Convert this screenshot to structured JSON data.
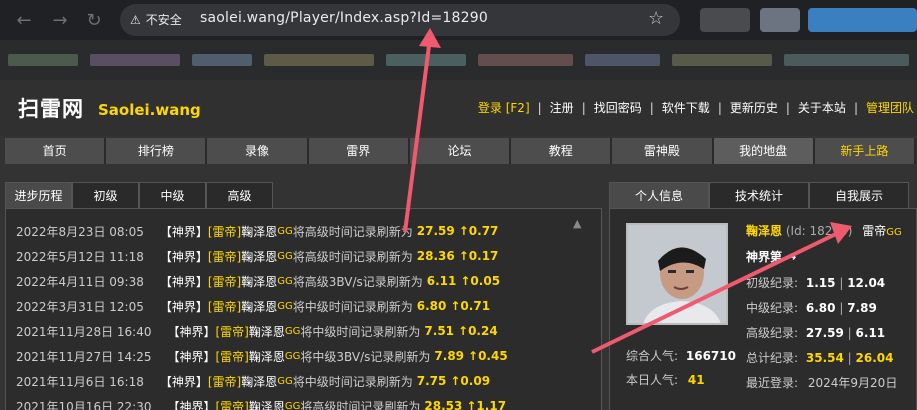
{
  "browser": {
    "security_label": "不安全",
    "url": "saolei.wang/Player/Index.asp?Id=18290"
  },
  "site": {
    "logo_cn": "扫雷网",
    "logo_en": "Saolei.wang",
    "top_links": [
      "登录 [F2]",
      "注册",
      "找回密码",
      "软件下载",
      "更新历史",
      "关于本站",
      "管理团队"
    ]
  },
  "nav": {
    "items": [
      "首页",
      "排行榜",
      "录像",
      "雷界",
      "论坛",
      "教程",
      "雷神殿",
      "我的地盘",
      "新手上路"
    ]
  },
  "left_tabs": [
    "进步历程",
    "初级",
    "中级",
    "高级"
  ],
  "records": [
    {
      "date": "2022年8月23日 08:05",
      "tag1": "【神界】",
      "tag2": "[雷帝]",
      "name": "鞠泽恩",
      "gg": "GG",
      "text": " 将高级时间记录刷新为",
      "value": "27.59",
      "inc": "↑0.77"
    },
    {
      "date": "2022年5月12日 11:18",
      "tag1": "【神界】",
      "tag2": "[雷帝]",
      "name": "鞠泽恩",
      "gg": "GG",
      "text": " 将高级时间记录刷新为",
      "value": "28.36",
      "inc": "↑0.17"
    },
    {
      "date": "2022年4月11日 09:38",
      "tag1": "【神界】",
      "tag2": "[雷帝]",
      "name": "鞠泽恩",
      "gg": "GG",
      "text": " 将高级3BV/s记录刷新为",
      "value": "6.11",
      "inc": "↑0.05"
    },
    {
      "date": "2022年3月31日 12:05",
      "tag1": "【神界】",
      "tag2": "[雷帝]",
      "name": "鞠泽恩",
      "gg": "GG",
      "text": " 将中级时间记录刷新为",
      "value": "6.80",
      "inc": "↑0.71"
    },
    {
      "date": "2021年11月28日 16:40",
      "tag1": "【神界】",
      "tag2": "[雷帝]",
      "name": "鞠泽恩",
      "gg": "GG",
      "text": " 将中级时间记录刷新为",
      "value": "7.51",
      "inc": "↑0.24"
    },
    {
      "date": "2021年11月27日 14:25",
      "tag1": "【神界】",
      "tag2": "[雷帝]",
      "name": "鞠泽恩",
      "gg": "GG",
      "text": " 将中级3BV/s记录刷新为",
      "value": "7.89",
      "inc": "↑0.45"
    },
    {
      "date": "2021年11月6日 16:18",
      "tag1": "【神界】",
      "tag2": "[雷帝]",
      "name": "鞠泽恩",
      "gg": "GG",
      "text": " 将中级时间记录刷新为",
      "value": "7.75",
      "inc": "↑0.09"
    },
    {
      "date": "2021年10月16日 22:30",
      "tag1": "【神界】",
      "tag2": "[雷帝]",
      "name": "鞠泽恩",
      "gg": "GG",
      "text": " 将高级时间记录刷新为",
      "value": "28.53",
      "inc": "↑1.17"
    }
  ],
  "right_tabs": [
    "个人信息",
    "技术统计",
    "自我展示"
  ],
  "profile": {
    "name": "鞠泽恩",
    "id_label": "(Id: 18290)",
    "rank": "雷帝",
    "rank_gg": "GG",
    "title": "神界第",
    "title_arrow": "→",
    "beg_label": "初级纪录:",
    "beg_value": "1.15",
    "beg_value2": "12.04",
    "int_label": "中级纪录:",
    "int_value": "6.80",
    "int_value2": "7.89",
    "exp_label": "高级纪录:",
    "exp_value": "27.59",
    "exp_value2": "6.11",
    "total_label": "总计纪录:",
    "total_value": "35.54",
    "total_value2": "26.04",
    "pop_label": "综合人气:",
    "pop_value": "166710",
    "today_label": "本日人气:",
    "today_value": "41",
    "last_label": "最近登录:",
    "last_value": "2024年9月20日"
  }
}
